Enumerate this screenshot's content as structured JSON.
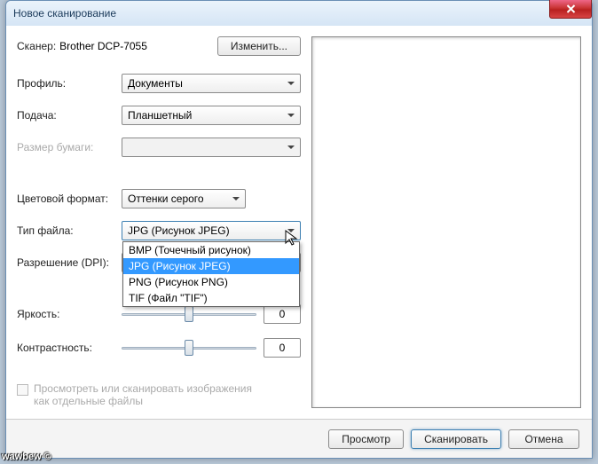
{
  "title": "Новое сканирование",
  "scanner": {
    "label": "Сканер:",
    "name": "Brother DCP-7055",
    "change_btn": "Изменить..."
  },
  "profile": {
    "label": "Профиль:",
    "value": "Документы"
  },
  "feed": {
    "label": "Подача:",
    "value": "Планшетный"
  },
  "paper_size": {
    "label": "Размер бумаги:",
    "value": ""
  },
  "color_format": {
    "label": "Цветовой формат:",
    "value": "Оттенки серого"
  },
  "file_type": {
    "label": "Тип файла:",
    "value": "JPG (Рисунок JPEG)",
    "options": [
      "BMP (Точечный рисунок)",
      "JPG (Рисунок JPEG)",
      "PNG (Рисунок PNG)",
      "TIF (Файл \"TIF\")"
    ],
    "selected_index": 1
  },
  "resolution": {
    "label": "Разрешение (DPI):",
    "value": ""
  },
  "brightness": {
    "label": "Яркость:",
    "value": "0"
  },
  "contrast": {
    "label": "Контрастность:",
    "value": "0"
  },
  "separate_files": {
    "label": "Просмотреть или сканировать изображения как отдельные файлы"
  },
  "footer": {
    "preview": "Просмотр",
    "scan": "Сканировать",
    "cancel": "Отмена"
  },
  "watermark": "wawbew ©"
}
